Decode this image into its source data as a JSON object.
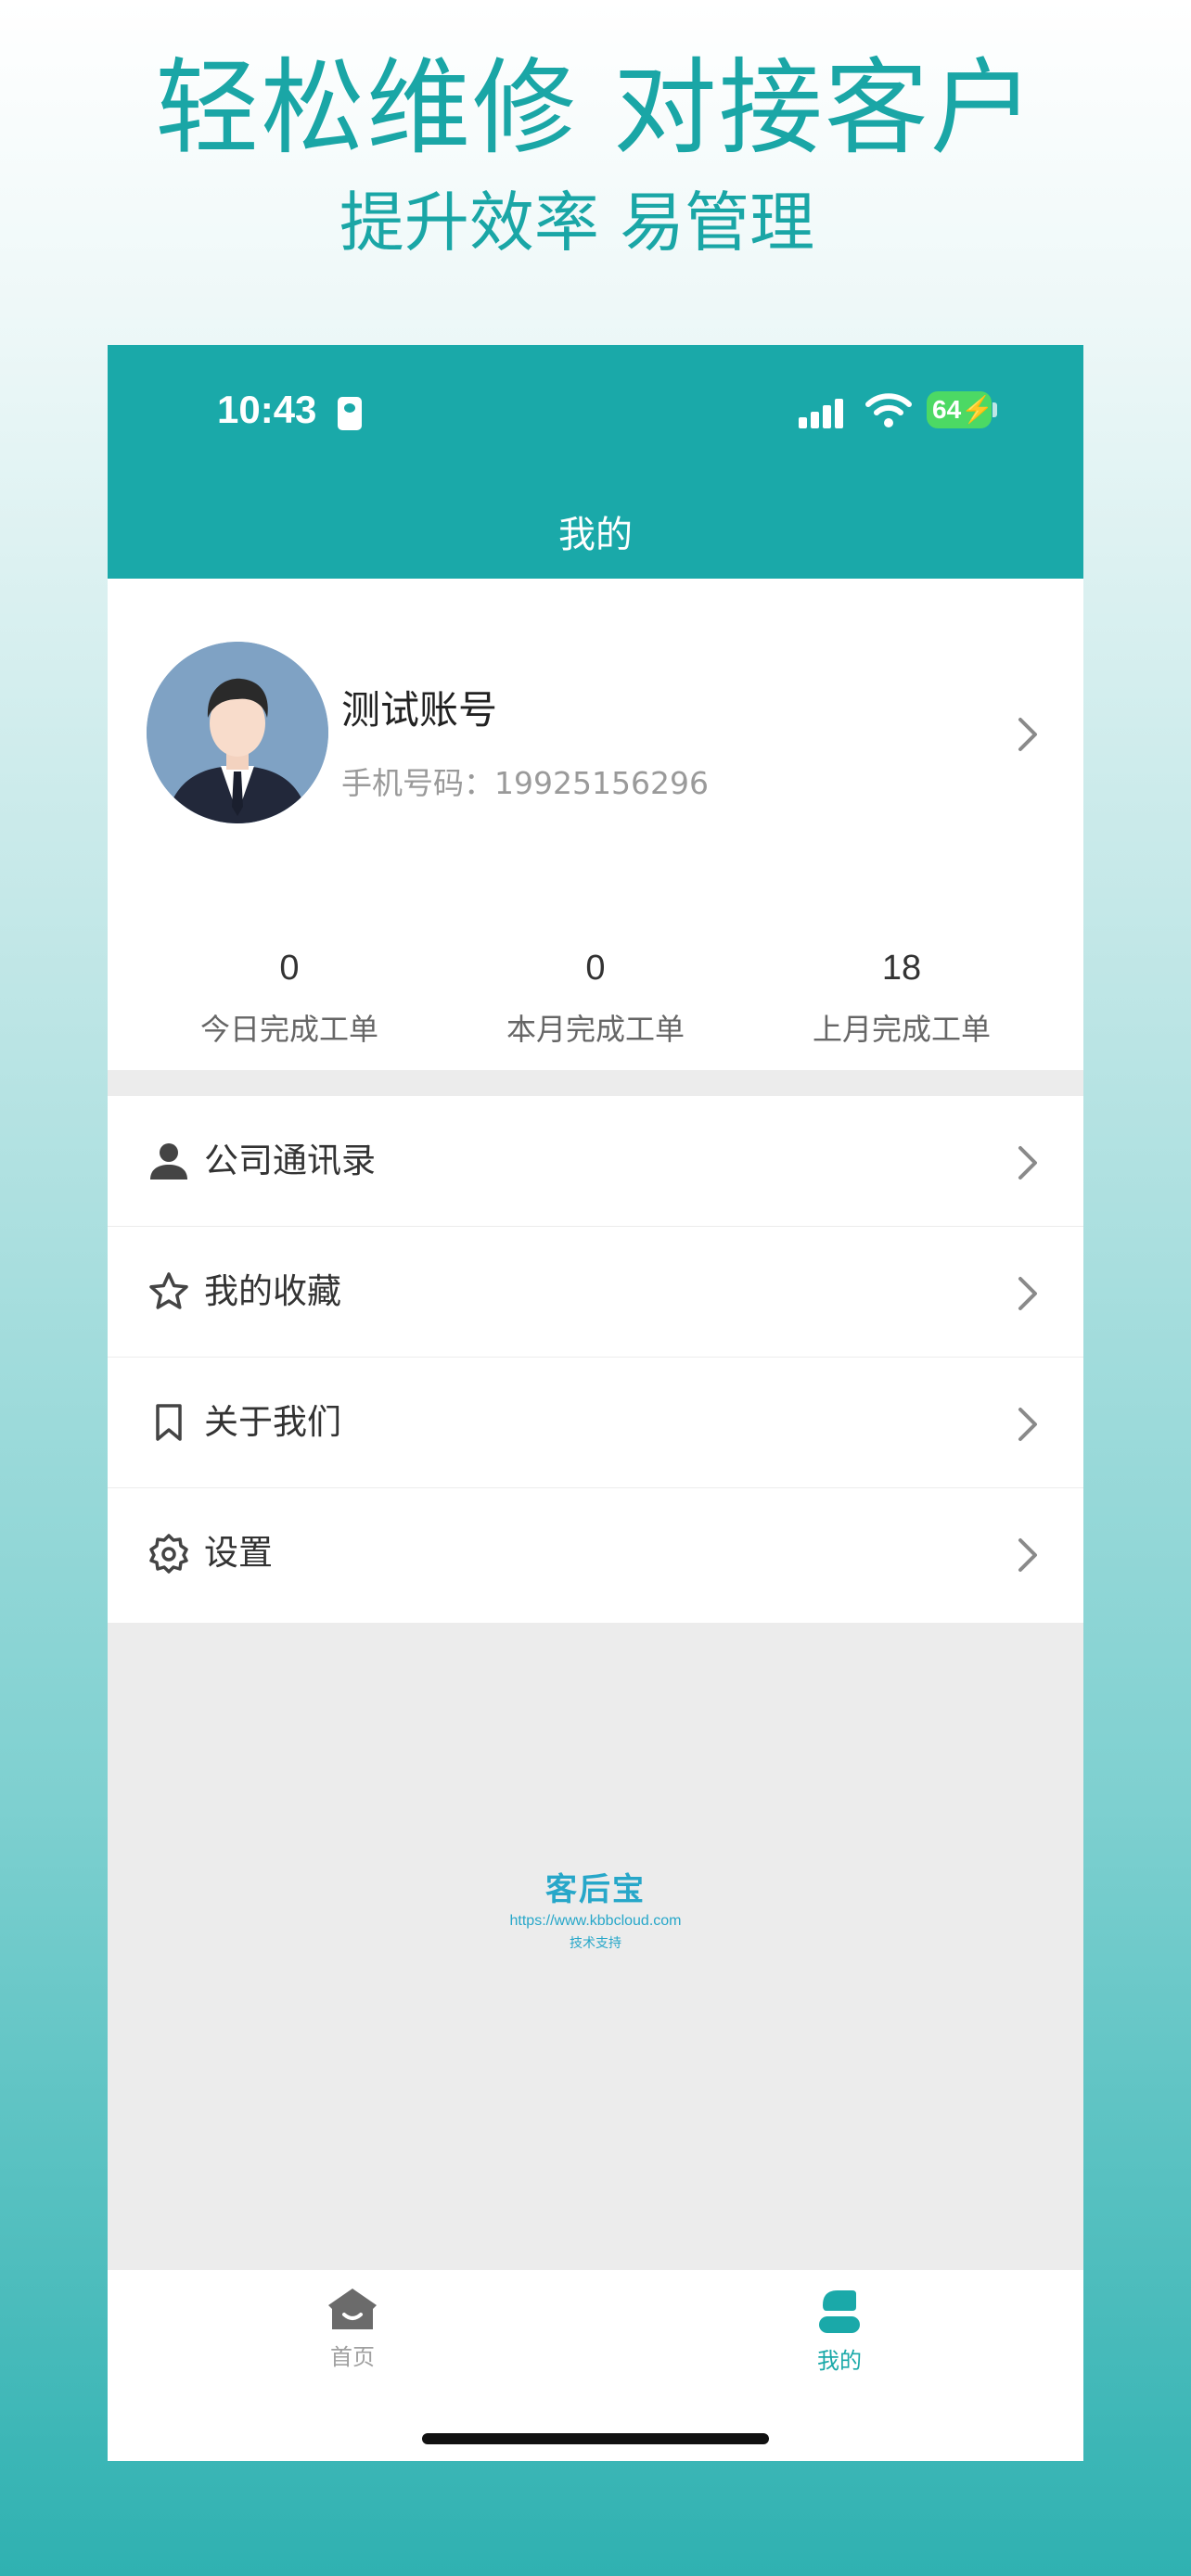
{
  "hero": {
    "line1": "轻松维修 对接客户",
    "line2": "提升效率 易管理"
  },
  "status_bar": {
    "time": "10:43",
    "battery": "64"
  },
  "nav": {
    "title": "我的"
  },
  "profile": {
    "name": "测试账号",
    "phone": "手机号码：19925156296"
  },
  "stats": [
    {
      "value": "0",
      "label": "今日完成工单"
    },
    {
      "value": "0",
      "label": "本月完成工单"
    },
    {
      "value": "18",
      "label": "上月完成工单"
    }
  ],
  "menu": [
    {
      "label": "公司通讯录",
      "icon": "person-icon"
    },
    {
      "label": "我的收藏",
      "icon": "star-icon"
    },
    {
      "label": "关于我们",
      "icon": "bookmark-icon"
    },
    {
      "label": "设置",
      "icon": "gear-icon"
    }
  ],
  "watermark": {
    "brand": "客后宝",
    "url": "https://www.kbbcloud.com",
    "caption": "技术支持"
  },
  "tabbar": [
    {
      "label": "首页",
      "icon": "home-icon",
      "active": false
    },
    {
      "label": "我的",
      "icon": "profile-icon",
      "active": true
    }
  ],
  "colors": {
    "accent": "#1aa9a9",
    "battery": "#4cd964",
    "inactive": "#a0a0a0"
  }
}
